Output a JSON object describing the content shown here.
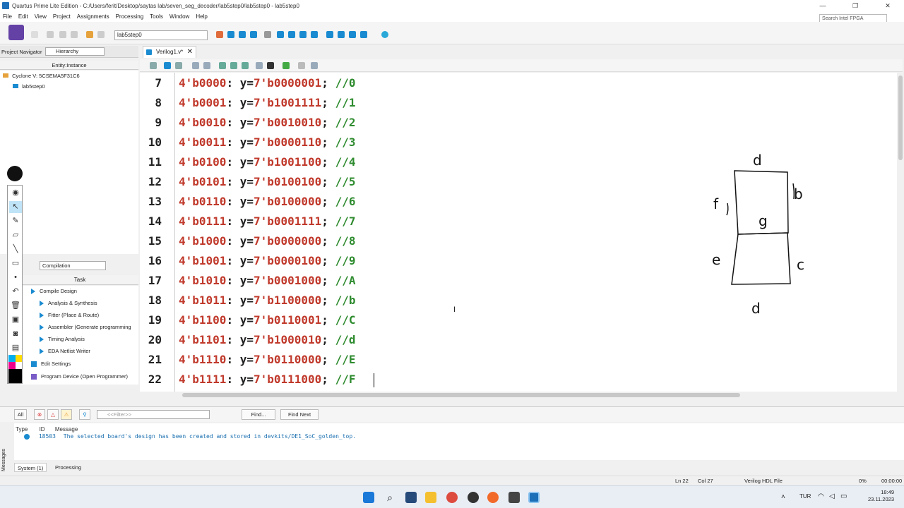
{
  "window": {
    "title": "Quartus Prime Lite Edition - C:/Users/ferit/Desktop/saytas lab/seven_seg_decoder/lab5step0/lab5step0 - lab5step0",
    "controls": [
      "—",
      "❐",
      "✕"
    ]
  },
  "menu": [
    "File",
    "Edit",
    "View",
    "Project",
    "Assignments",
    "Processing",
    "Tools",
    "Window",
    "Help"
  ],
  "toolbar": {
    "revision": "lab5step0",
    "search_placeholder": "Search Intel FPGA"
  },
  "navigator": {
    "label": "Project Navigator",
    "view": "Hierarchy",
    "column": "Entity:Instance",
    "device": "Cyclone V: 5CSEMA5F31C6",
    "top_entity": "lab5step0"
  },
  "tasks": {
    "flow": "Compilation",
    "column": "Task",
    "items": [
      "Compile Design",
      "Analysis & Synthesis",
      "Fitter (Place & Route)",
      "Assembler (Generate programming",
      "Timing Analysis",
      "EDA Netlist Writer",
      "Edit Settings",
      "Program Device (Open Programmer)"
    ]
  },
  "editor": {
    "tab": "Verilog1.v*",
    "lines": [
      {
        "n": "7",
        "lit": "4'b0000",
        "val": "7'b0000001",
        "cm": "//0"
      },
      {
        "n": "8",
        "lit": "4'b0001",
        "val": "7'b1001111",
        "cm": "//1"
      },
      {
        "n": "9",
        "lit": "4'b0010",
        "val": "7'b0010010",
        "cm": "//2"
      },
      {
        "n": "10",
        "lit": "4'b0011",
        "val": "7'b0000110",
        "cm": "//3"
      },
      {
        "n": "11",
        "lit": "4'b0100",
        "val": "7'b1001100",
        "cm": "//4"
      },
      {
        "n": "12",
        "lit": "4'b0101",
        "val": "7'b0100100",
        "cm": "//5"
      },
      {
        "n": "13",
        "lit": "4'b0110",
        "val": "7'b0100000",
        "cm": "//6"
      },
      {
        "n": "14",
        "lit": "4'b0111",
        "val": "7'b0001111",
        "cm": "//7"
      },
      {
        "n": "15",
        "lit": "4'b1000",
        "val": "7'b0000000",
        "cm": "//8"
      },
      {
        "n": "16",
        "lit": "4'b1001",
        "val": "7'b0000100",
        "cm": "//9"
      },
      {
        "n": "17",
        "lit": "4'b1010",
        "val": "7'b0001000",
        "cm": "//A"
      },
      {
        "n": "18",
        "lit": "4'b1011",
        "val": "7'b1100000",
        "cm": "//b"
      },
      {
        "n": "19",
        "lit": "4'b1100",
        "val": "7'b0110001",
        "cm": "//C"
      },
      {
        "n": "20",
        "lit": "4'b1101",
        "val": "7'b1000010",
        "cm": "//d"
      },
      {
        "n": "21",
        "lit": "4'b1110",
        "val": "7'b0110000",
        "cm": "//E"
      },
      {
        "n": "22",
        "lit": "4'b1111",
        "val": "7'b0111000",
        "cm": "//F"
      }
    ],
    "sketch_labels": {
      "top": "d",
      "right_top": "b",
      "left_top": "f",
      "middle": "g",
      "left_bottom": "e",
      "right_bottom": "c",
      "bottom": "d"
    }
  },
  "messages": {
    "all": "All",
    "filter_placeholder": "<<Filter>>",
    "find": "Find...",
    "find_next": "Find Next",
    "col_type": "Type",
    "col_id": "ID",
    "col_message": "Message",
    "row_id": "18503",
    "row_text": "The selected board's design has been created and stored in devkits/DE1_SoC_golden_top.",
    "side_label": "Messages",
    "tab_system": "System (1)",
    "tab_processing": "Processing"
  },
  "status": {
    "line": "Ln 22",
    "col": "Col 27",
    "filetype": "Verilog HDL File",
    "progress": "0%",
    "time": "00:00:00"
  },
  "taskbar": {
    "lang": "TUR",
    "time": "18:49",
    "date": "23.11.2023"
  },
  "colors": {
    "literal": "#c0392b",
    "comment": "#2e8b2e",
    "accent": "#1a8bd0"
  }
}
